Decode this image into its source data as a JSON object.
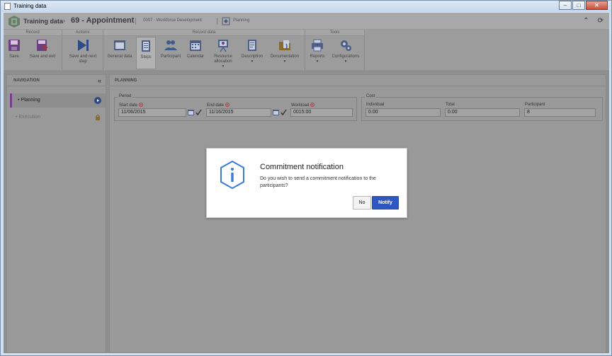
{
  "window": {
    "title": "Training data",
    "controls": {
      "minimize": "–",
      "maximize": "□",
      "close": "✕"
    }
  },
  "header": {
    "section": "Training data",
    "separator": "›",
    "record": "69 - Appointment",
    "department": "0007 - Workforce Development",
    "phase": "Planning",
    "collapse_glyph": "⌃",
    "refresh_glyph": "⟳"
  },
  "ribbon": {
    "groups": {
      "record": "Record",
      "actions": "Actions",
      "record_data": "Record data",
      "tools": "Tools"
    },
    "buttons": {
      "save": "Save",
      "save_exit": "Save and exit",
      "save_next_line1": "Save and next",
      "save_next_line2": "step",
      "general_data": "General data",
      "steps": "Steps",
      "participant": "Participant",
      "calendar": "Calendar",
      "resource_line1": "Resource",
      "resource_line2": "allocation",
      "description": "Description",
      "documentation": "Documentation",
      "reports": "Reports",
      "configurations": "Configurations",
      "caret": "▼"
    }
  },
  "navigation": {
    "title": "NAVIGATION",
    "collapse": "«",
    "items": [
      {
        "label": "Planning",
        "bullet": "•"
      },
      {
        "label": "Execution",
        "bullet": "•"
      }
    ]
  },
  "main": {
    "title": "PLANNING",
    "period": {
      "legend": "Period",
      "start_label": "Start date",
      "start_value": "11/06/2015",
      "end_label": "End date",
      "end_value": "11/16/2015",
      "workload_label": "Workload",
      "workload_value": "0015:00"
    },
    "cost": {
      "legend": "Cost",
      "individual_label": "Individual",
      "individual_value": "0.00",
      "total_label": "Total",
      "total_value": "0.00",
      "participant_label": "Participant",
      "participant_value": "8"
    }
  },
  "dialog": {
    "title": "Commitment notification",
    "message": "Do you wish to send a commitment notification to the participants?",
    "no_label": "No",
    "notify_label": "Notify",
    "icon_glyph": "i"
  },
  "colors": {
    "accent_blue": "#2e57c2",
    "icon_blue": "#3a7cd5",
    "nav_selected_bar": "#7b3f8f",
    "required_marker": "#b04040"
  }
}
